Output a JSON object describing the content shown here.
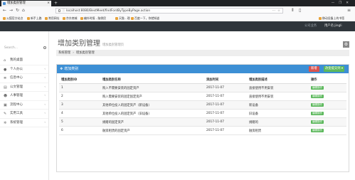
{
  "browser": {
    "tab_title": "增加类别管理",
    "url": "localhost:8080/BestMeet/findFontByTypeByPage.action",
    "bookmarks": [
      "火狐官方站点",
      "新手上路",
      "常用网址",
      "京东商城",
      "编外时报 - 脑袋民",
      "天猫 - 理",
      "百度一下，你就知道"
    ],
    "mobile_bookmarks": "移动设备上的书签"
  },
  "topbar": {
    "link": "公司业务",
    "user": "用户名:jingli"
  },
  "sidebar": {
    "search_placeholder": "Search...",
    "items": [
      {
        "label": "我的桌面",
        "icon": "home-icon"
      },
      {
        "label": "个人办公",
        "icon": "user-icon"
      },
      {
        "label": "信息中心",
        "icon": "list-icon"
      },
      {
        "label": "公文管理",
        "icon": "document-icon"
      },
      {
        "label": "人事管理",
        "icon": "people-icon"
      },
      {
        "label": "流程中心",
        "icon": "flow-icon"
      },
      {
        "label": "实用工具",
        "icon": "wrench-icon"
      },
      {
        "label": "系统管理",
        "icon": "gear-icon"
      }
    ]
  },
  "page": {
    "title": "增加类别管理",
    "subtitle": "增加类别管理页",
    "breadcrumb": [
      "系统管理",
      "增加类别管理"
    ]
  },
  "panel": {
    "title": "增加类别",
    "add_label": "新增",
    "save_label": "改变提交列 ▾",
    "columns": [
      "增加类别ID",
      "增加类别名称",
      "添加时间",
      "增加类别描述",
      "操作"
    ],
    "edit_label": "编辑操作",
    "rows": [
      {
        "id": "1",
        "name": "购入不需要安装的固定资产",
        "date": "2017-11-07",
        "desc": "直接使用不用安装"
      },
      {
        "id": "2",
        "name": "购入需要安装的固定固定资产",
        "date": "2017-11-07",
        "desc": "直接使用不用安装"
      },
      {
        "id": "3",
        "name": "其他单位投入的固定资产（新设备）",
        "date": "2017-11-07",
        "desc": "新设备"
      },
      {
        "id": "4",
        "name": "其他单位投入的固定资产（旧设备）",
        "date": "2017-11-07",
        "desc": "旧设备"
      },
      {
        "id": "5",
        "name": "捐赠的固定资产",
        "date": "2017-11-07",
        "desc": "捐赠的"
      },
      {
        "id": "6",
        "name": "融资租赁的固定资产",
        "date": "2017-11-07",
        "desc": "融资租赁"
      }
    ]
  },
  "colors": {
    "topbar": "#2f353b",
    "panel_header": "#3c8fd5",
    "add_button": "#d9534f",
    "save_button": "#5cb85c"
  }
}
